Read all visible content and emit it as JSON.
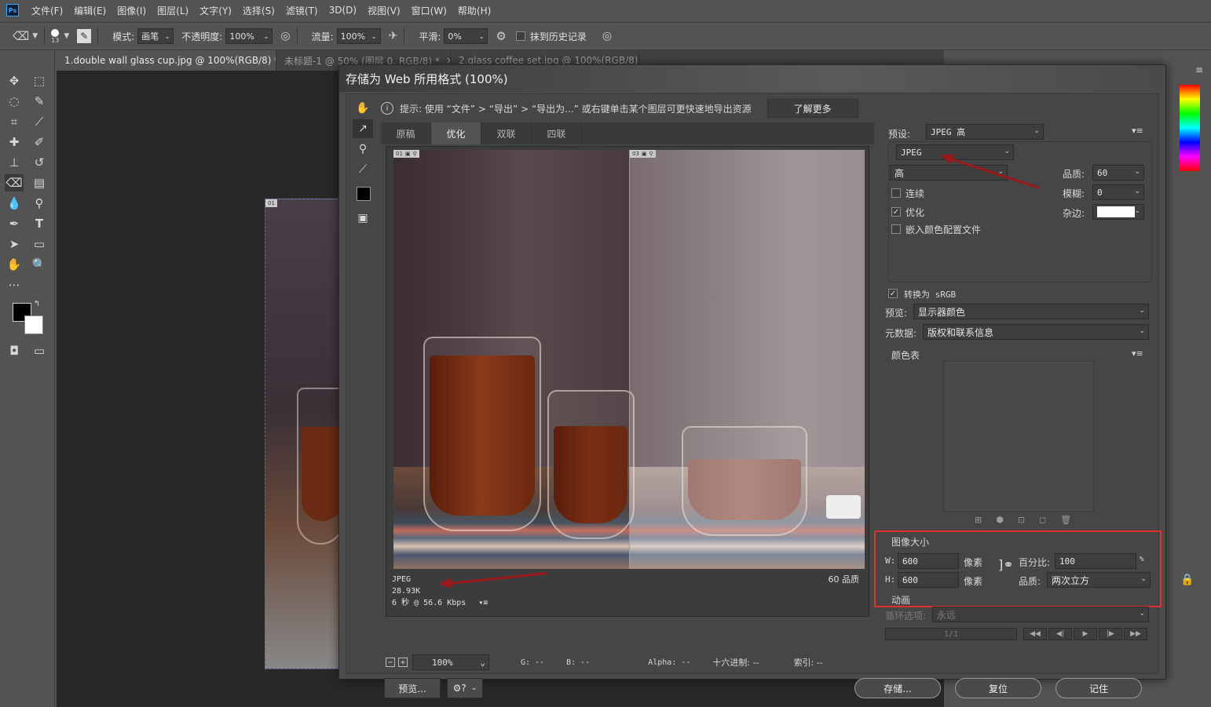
{
  "app": {
    "logo": "Ps"
  },
  "menu": [
    "文件(F)",
    "编辑(E)",
    "图像(I)",
    "图层(L)",
    "文字(Y)",
    "选择(S)",
    "滤镜(T)",
    "3D(D)",
    "视图(V)",
    "窗口(W)",
    "帮助(H)"
  ],
  "options": {
    "brush_size": "13",
    "mode_label": "模式:",
    "mode_value": "画笔",
    "opacity_label": "不透明度:",
    "opacity_value": "100%",
    "flow_label": "流量:",
    "flow_value": "100%",
    "smooth_label": "平滑:",
    "smooth_value": "0%",
    "erase_history": "抹到历史记录"
  },
  "doc_tabs": [
    {
      "label": "1.double wall glass cup.jpg @ 100%(RGB/8) *",
      "close": "×"
    },
    {
      "label": "未标题-1 @ 50% (图层 0, RGB/8) *",
      "close": "×"
    },
    {
      "label": "2.glass coffee set.jpg @ 100%(RGB/8)",
      "close": "×"
    }
  ],
  "bg_doc_badge": "01",
  "dialog": {
    "title": "存储为 Web 所用格式 (100%)",
    "hint": "提示: 使用 “文件” > “导出” > “导出为...” 或右键单击某个图层可更快速地导出资源",
    "learn_more": "了解更多",
    "view_tabs": [
      "原稿",
      "优化",
      "双联",
      "四联"
    ],
    "left_badge": "01",
    "right_badge": "03",
    "left_info": {
      "format": "JPEG",
      "size": "28.93K",
      "time": "6 秒 @ 56.6 Kbps"
    },
    "right_info": "60 品质",
    "zoom": "100%",
    "readout": {
      "g": "G: --",
      "b": "B: --",
      "alpha": "Alpha: --",
      "hex": "十六进制: --",
      "index": "索引: --"
    },
    "preview_btn": "预览...",
    "save_btn": "存储...",
    "reset_btn": "复位",
    "remember_btn": "记住"
  },
  "settings": {
    "preset_label": "预设:",
    "preset_value": "JPEG 高",
    "format": "JPEG",
    "quality_level": "高",
    "quality_label": "品质:",
    "quality_value": "60",
    "blur_label": "模糊:",
    "blur_value": "0",
    "matte_label": "杂边:",
    "progressive": "连续",
    "optimized": "优化",
    "embed_profile": "嵌入颜色配置文件",
    "convert_srgb": "转换为 sRGB",
    "preview_label": "预览:",
    "preview_value": "显示器颜色",
    "metadata_label": "元数据:",
    "metadata_value": "版权和联系信息",
    "color_table": "颜色表",
    "image_size": "图像大小",
    "w_label": "W:",
    "w_value": "600",
    "h_label": "H:",
    "h_value": "600",
    "px": "像素",
    "percent_label": "百分比:",
    "percent_value": "100",
    "percent_unit": "%",
    "resample_label": "品质:",
    "resample_value": "两次立方",
    "animation": "动画",
    "loop_label": "循环选项:",
    "loop_value": "永远",
    "frame": "1/1"
  },
  "colors": {
    "accent_red": "#e03030",
    "arrow": "#9a1a1a"
  }
}
